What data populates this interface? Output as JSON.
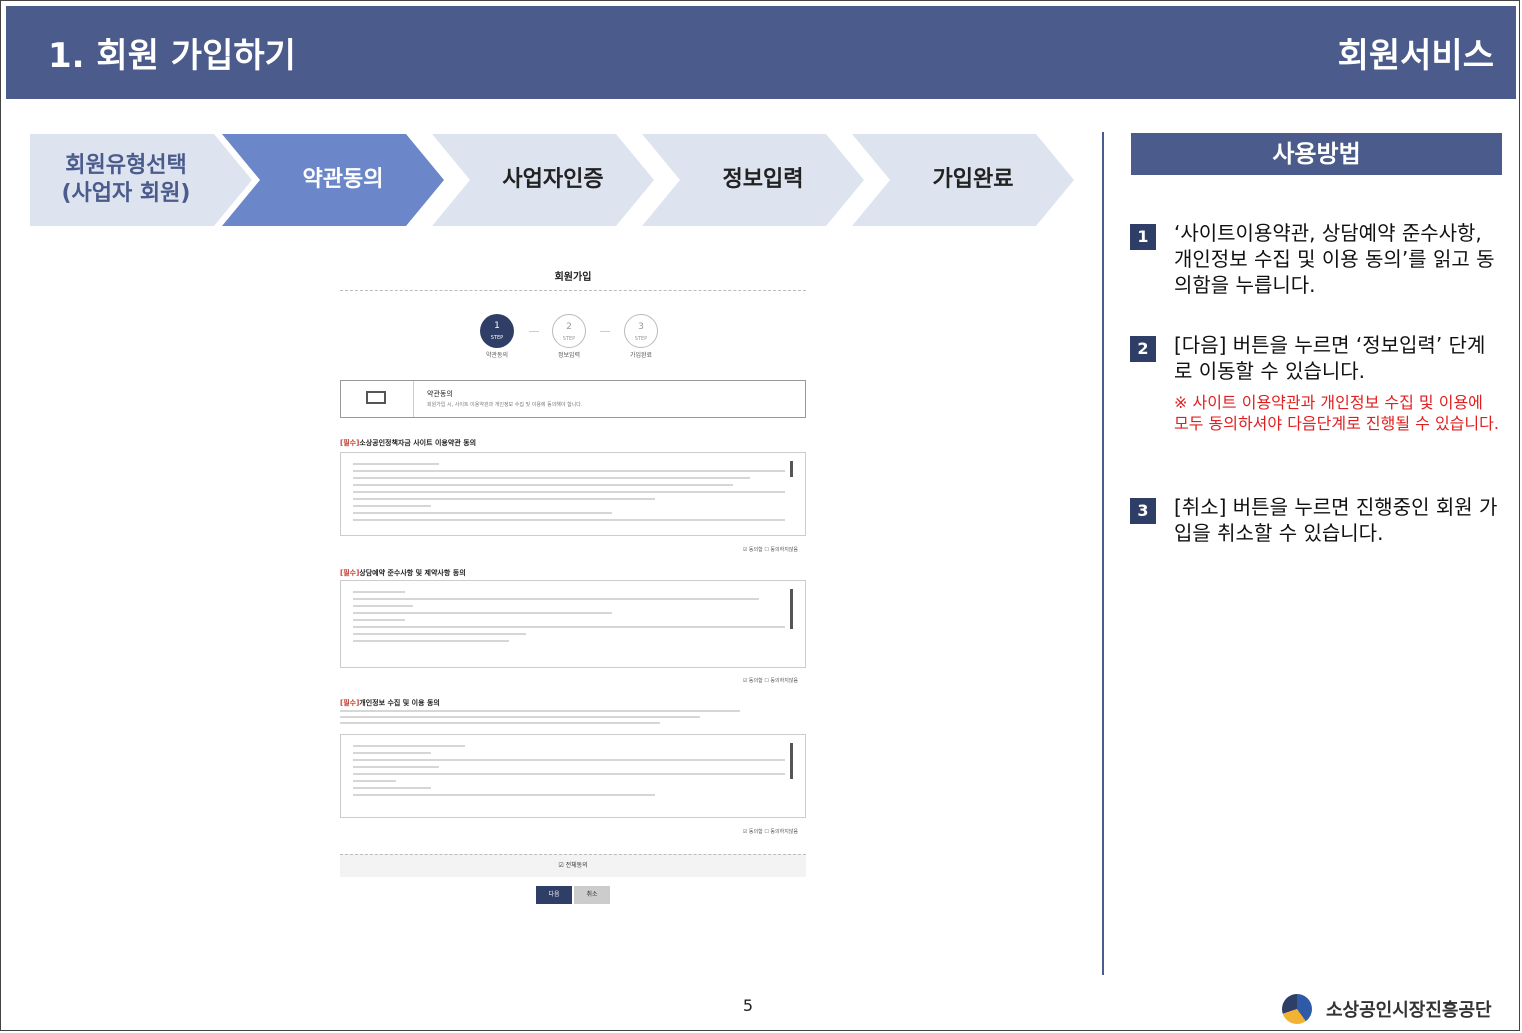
{
  "header": {
    "title": "1. 회원 가입하기",
    "service": "회원서비스"
  },
  "steps": [
    {
      "label_line1": "회원유형선택",
      "label_line2": "(사업자 회원)"
    },
    {
      "label": "약관동의"
    },
    {
      "label": "사업자인증"
    },
    {
      "label": "정보입력"
    },
    {
      "label": "가입완료"
    }
  ],
  "screenshot": {
    "heading": "회원가입",
    "mini_steps": [
      {
        "num": "1",
        "sub": "STEP",
        "label": "약관동의"
      },
      {
        "num": "2",
        "sub": "STEP",
        "label": "정보입력"
      },
      {
        "num": "3",
        "sub": "STEP",
        "label": "가입완료"
      }
    ],
    "info_title": "약관동의",
    "info_desc": "회원가입 시, 사이트 이용약관과 개인정보 수집 및 이용에 동의해야 합니다.",
    "sections": [
      {
        "req": "[필수]",
        "title": "소상공인정책자금 사이트 이용약관 동의"
      },
      {
        "req": "[필수]",
        "title": "상담예약 준수사항 및 제약사항 동의"
      },
      {
        "req": "[필수]",
        "title": "개인정보 수집 및 이용 동의"
      }
    ],
    "agree_label": "☑ 동의함  ☐ 동의하지않음",
    "all_agree": "☑ 전체동의",
    "next_button": "다음",
    "cancel_button": "취소"
  },
  "sidebar": {
    "heading": "사용방법",
    "items": [
      {
        "num": "1",
        "text": "‘사이트이용약관, 상담예약 준수사항, 개인정보 수집 및 이용 동의’를 읽고 동의함을 누릅니다."
      },
      {
        "num": "2",
        "text": "[다음] 버튼을 누르면 ‘정보입력’ 단계로 이동할 수 있습니다.",
        "note": "※ 사이트 이용약관과 개인정보 수집 및 이용에 모두 동의하셔야 다음단계로 진행될 수 있습니다."
      },
      {
        "num": "3",
        "text": "[취소] 버튼을 누르면 진행중인 회원 가입을 취소할 수 있습니다."
      }
    ]
  },
  "footer": {
    "page": "5",
    "org": "소상공인시장진흥공단"
  }
}
